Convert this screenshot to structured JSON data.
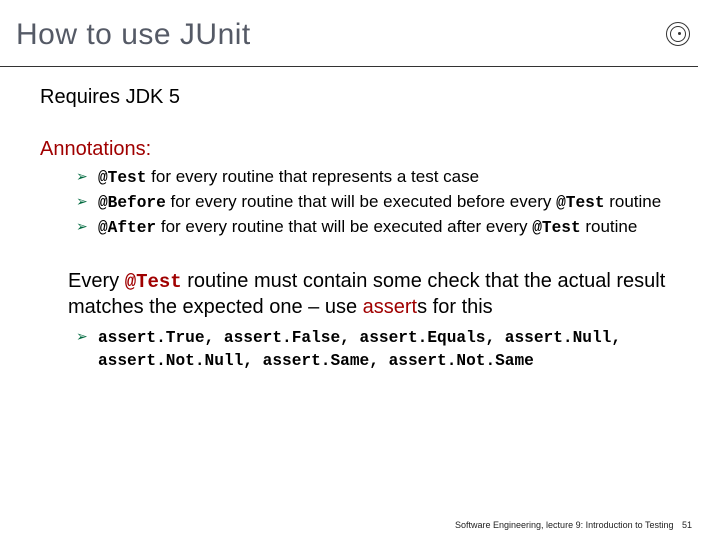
{
  "title": "How to use JUnit",
  "requires": "Requires JDK 5",
  "annotations_label": "Annotations:",
  "annotations": [
    {
      "code": "@Test",
      "rest": " for every routine that represents a test case"
    },
    {
      "code": "@Before",
      "rest": " for every routine that will be executed before every ",
      "code2": "@Test",
      "rest2": " routine"
    },
    {
      "code": "@After",
      "rest": " for every routine that will be executed after every ",
      "code2": "@Test",
      "rest2": " routine"
    }
  ],
  "body_pre": "Every ",
  "body_code": "@Test",
  "body_mid": " routine must contain some check that the actual result matches the expected one – use ",
  "body_assert": "assert",
  "body_post": "s for this",
  "assert_list": "assert.True, assert.False, assert.Equals, assert.Null, assert.Not.Null, assert.Same, assert.Not.Same",
  "footer_text": "Software Engineering, lecture 9: Introduction to Testing",
  "page_number": "51"
}
